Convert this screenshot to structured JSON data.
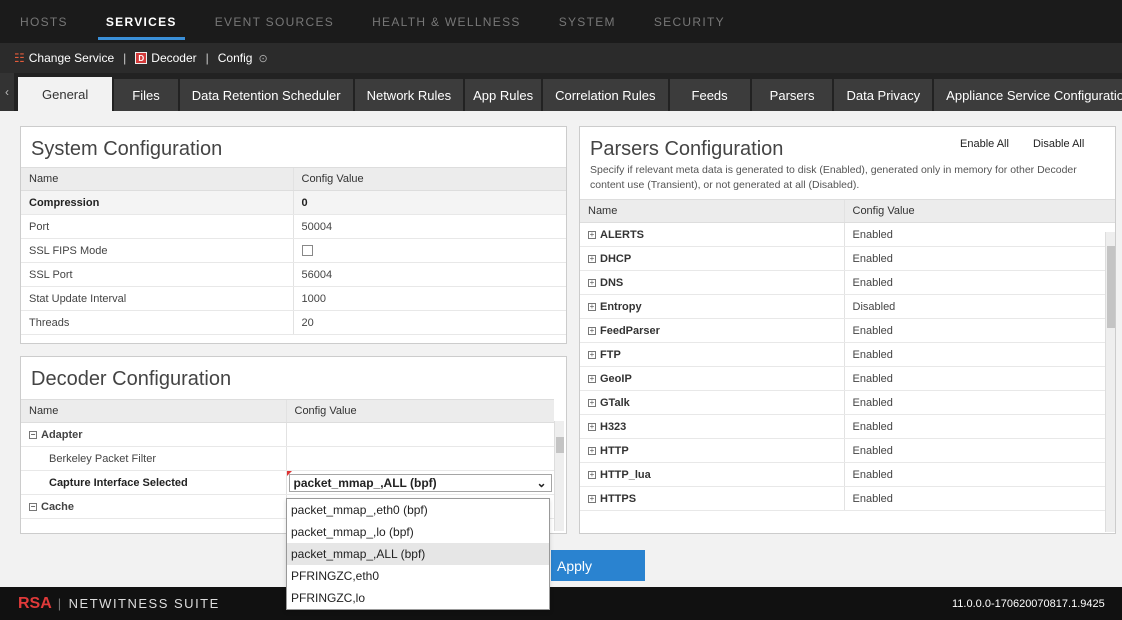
{
  "topnav": [
    "HOSTS",
    "SERVICES",
    "EVENT SOURCES",
    "HEALTH & WELLNESS",
    "SYSTEM",
    "SECURITY"
  ],
  "svcbar": {
    "change_service": "Change Service",
    "decoder": "Decoder",
    "config": "Config"
  },
  "tabs": [
    "General",
    "Files",
    "Data Retention Scheduler",
    "Network Rules",
    "App Rules",
    "Correlation Rules",
    "Feeds",
    "Parsers",
    "Data Privacy",
    "Appliance Service Configuration"
  ],
  "system_config": {
    "title": "System Configuration",
    "columns": [
      "Name",
      "Config Value"
    ],
    "rows": [
      {
        "name": "Compression",
        "value": "0"
      },
      {
        "name": "Port",
        "value": "50004"
      },
      {
        "name": "SSL FIPS Mode",
        "value": ""
      },
      {
        "name": "SSL Port",
        "value": "56004"
      },
      {
        "name": "Stat Update Interval",
        "value": "1000"
      },
      {
        "name": "Threads",
        "value": "20"
      }
    ]
  },
  "decoder_config": {
    "title": "Decoder Configuration",
    "columns": [
      "Name",
      "Config Value"
    ],
    "adapter": "Adapter",
    "bpf": "Berkeley Packet Filter",
    "capture": "Capture Interface Selected",
    "capture_value": "packet_mmap_,ALL (bpf)",
    "cache": "Cache"
  },
  "dropdown_options": [
    "packet_mmap_,eth0 (bpf)",
    "packet_mmap_,lo (bpf)",
    "packet_mmap_,ALL (bpf)",
    "PFRINGZC,eth0",
    "PFRINGZC,lo"
  ],
  "apply_label": "Apply",
  "parsers": {
    "title": "Parsers Configuration",
    "enable_all": "Enable All",
    "disable_all": "Disable All",
    "desc": "Specify if relevant meta data is generated to disk (Enabled), generated only in memory for other Decoder content use (Transient), or not generated at all (Disabled).",
    "columns": [
      "Name",
      "Config Value"
    ],
    "rows": [
      {
        "name": "ALERTS",
        "value": "Enabled"
      },
      {
        "name": "DHCP",
        "value": "Enabled"
      },
      {
        "name": "DNS",
        "value": "Enabled"
      },
      {
        "name": "Entropy",
        "value": "Disabled"
      },
      {
        "name": "FeedParser",
        "value": "Enabled"
      },
      {
        "name": "FTP",
        "value": "Enabled"
      },
      {
        "name": "GeoIP",
        "value": "Enabled"
      },
      {
        "name": "GTalk",
        "value": "Enabled"
      },
      {
        "name": "H323",
        "value": "Enabled"
      },
      {
        "name": "HTTP",
        "value": "Enabled"
      },
      {
        "name": "HTTP_lua",
        "value": "Enabled"
      },
      {
        "name": "HTTPS",
        "value": "Enabled"
      }
    ]
  },
  "footer": {
    "rsa": "RSA",
    "suite": "NETWITNESS SUITE",
    "version": "11.0.0.0-170620070817.1.9425"
  }
}
